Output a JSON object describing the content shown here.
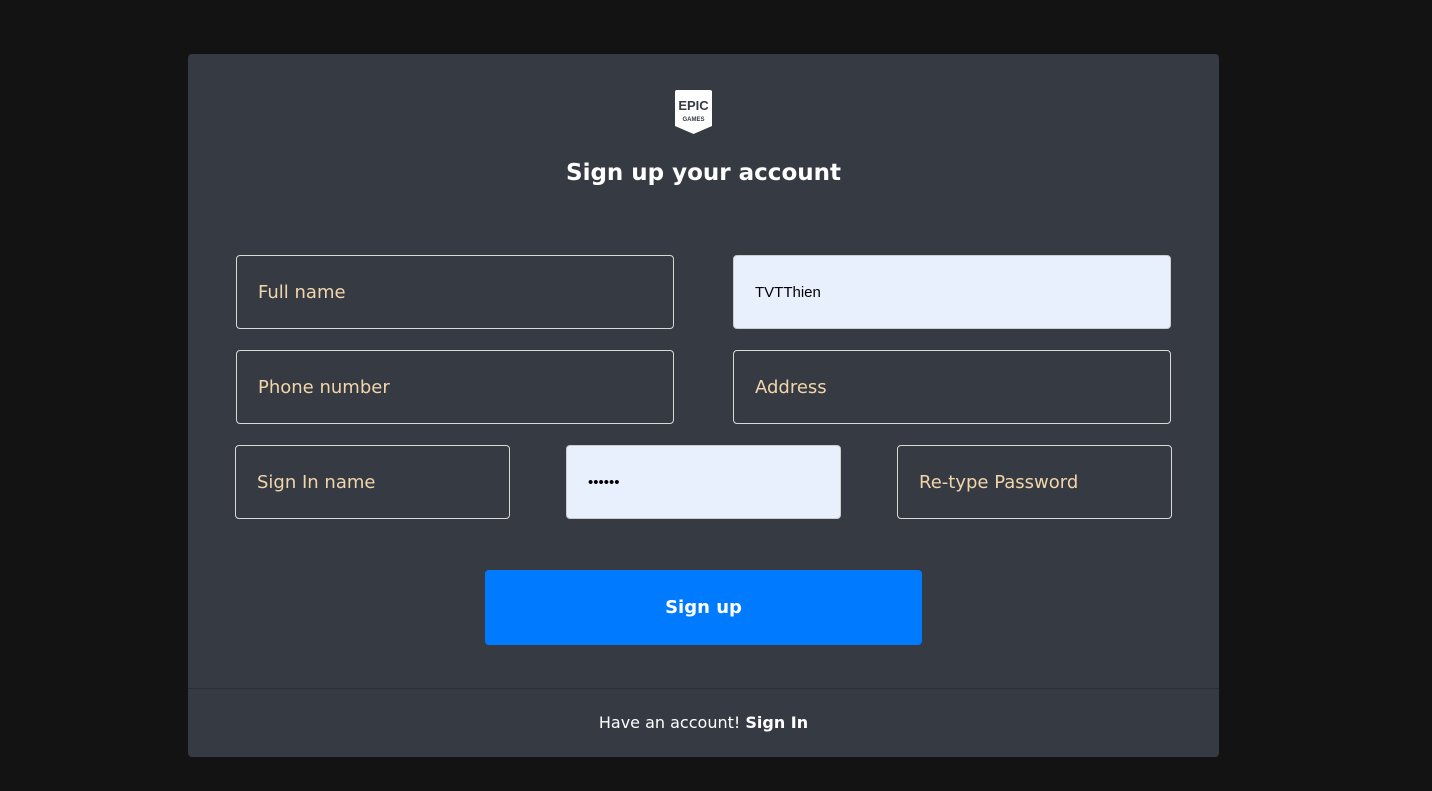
{
  "logo": {
    "line1": "EPIC",
    "line2": "GAMES"
  },
  "title": "Sign up your account",
  "fields": {
    "full_name": {
      "placeholder": "Full name",
      "value": ""
    },
    "email": {
      "value": "TVTThien"
    },
    "phone": {
      "placeholder": "Phone number"
    },
    "address": {
      "placeholder": "Address"
    },
    "signin_name": {
      "placeholder": "Sign In name"
    },
    "password": {
      "value": "••••••"
    },
    "retype_password": {
      "placeholder": "Re-type Password"
    }
  },
  "submit_label": "Sign up",
  "footer": {
    "text": "Have an account! ",
    "link": "Sign In"
  },
  "colors": {
    "accent": "#007bff",
    "card": "#363a42",
    "placeholder": "#f1d6ac"
  }
}
